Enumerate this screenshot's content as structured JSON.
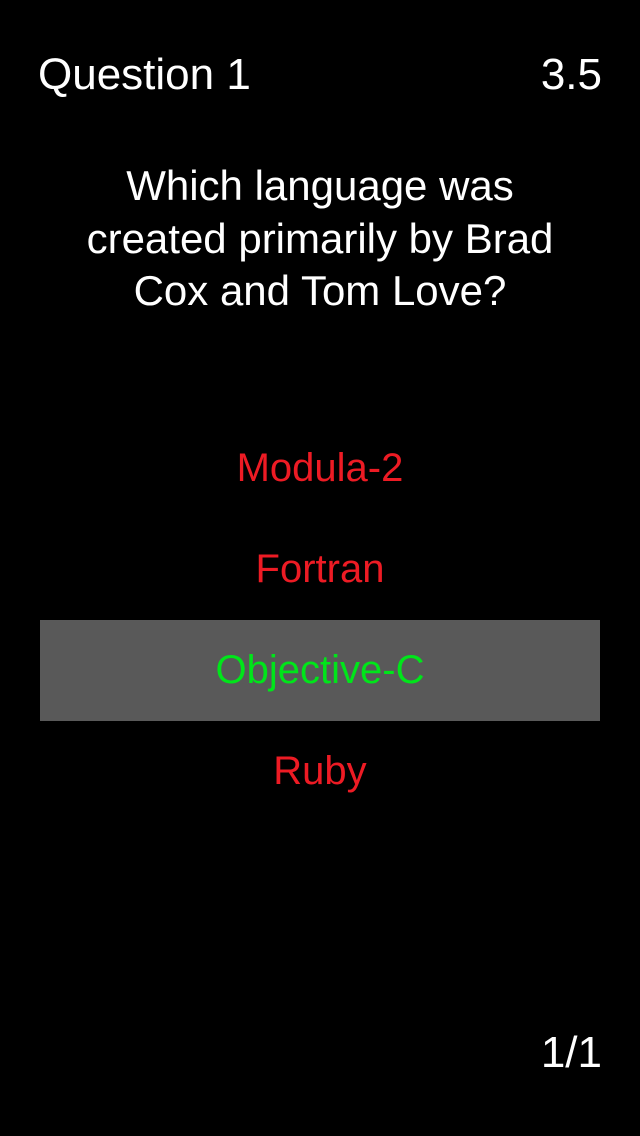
{
  "header": {
    "question_label": "Question  1",
    "timer": "3.5"
  },
  "question": "Which language was created primarily by Brad Cox and Tom Love?",
  "answers": [
    {
      "label": "Modula-2",
      "state": "incorrect"
    },
    {
      "label": "Fortran",
      "state": "incorrect"
    },
    {
      "label": "Objective-C",
      "state": "correct"
    },
    {
      "label": "Ruby",
      "state": "incorrect"
    }
  ],
  "score": "1/1"
}
